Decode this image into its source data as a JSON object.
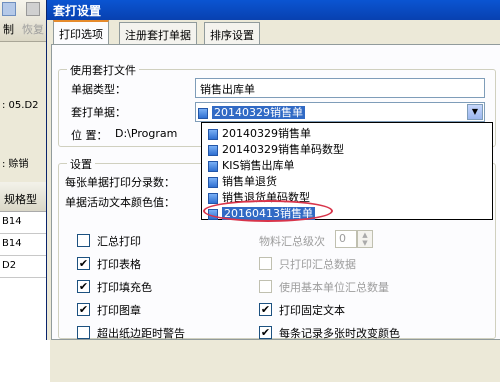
{
  "background_app": {
    "toolbar": {
      "item1": "制",
      "item2": "恢复"
    },
    "left_panel": {
      "date_label": ":  05.D2",
      "sale_label": ":  赊销",
      "column_header": "规格型",
      "rows": [
        "B14",
        "B14",
        "D2"
      ]
    }
  },
  "dialog": {
    "title": "套打设置",
    "tabs": [
      {
        "label": "打印选项"
      },
      {
        "label": "注册套打单据"
      },
      {
        "label": "排序设置"
      }
    ],
    "use_file_group": {
      "legend": "使用套打文件",
      "doc_type_label": "单据类型：",
      "doc_type_value": "销售出库单",
      "print_doc_label": "套打单据：",
      "print_doc_value": "20140329销售单",
      "position_label": "位    置：",
      "position_value": "D:\\Program"
    },
    "settings_group": {
      "legend": "设置",
      "per_page_label": "每张单据打印分录数：",
      "text_color_label": "单据活动文本颜色值："
    },
    "dropdown_options": [
      "20140329销售单",
      "20140329销售单码数型",
      "KIS销售出库单",
      "销售单退货",
      "销售退货单码数型",
      "20160413销售单"
    ],
    "checkboxes_left": [
      {
        "label": "汇总打印",
        "checked": false
      },
      {
        "label": "打印表格",
        "checked": true
      },
      {
        "label": "打印填充色",
        "checked": true
      },
      {
        "label": "打印图章",
        "checked": true
      },
      {
        "label": "超出纸边距时警告",
        "checked": false
      }
    ],
    "checkboxes_right": [
      {
        "label": "物料汇总级次",
        "value": "0",
        "disabled": true
      },
      {
        "label": "只打印汇总数据",
        "checked": false,
        "disabled": true
      },
      {
        "label": "使用基本单位汇总数量",
        "checked": false,
        "disabled": true
      },
      {
        "label": "打印固定文本",
        "checked": true,
        "disabled": false
      },
      {
        "label": "每条记录多张时改变颜色",
        "checked": true,
        "disabled": false
      }
    ],
    "check_mark": "✔",
    "colors": {
      "titlebar": "#0a55d2",
      "selected_item": "#316ac5",
      "highlight_circle": "#d8344a",
      "active_tab_accent": "#e68b2c"
    }
  }
}
